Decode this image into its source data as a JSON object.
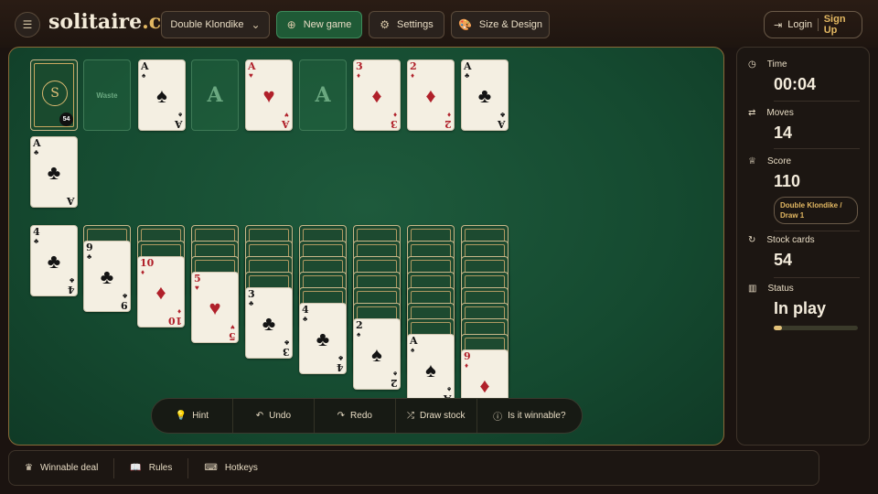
{
  "header": {
    "logo": {
      "main": "solitaire",
      "tld": ".cx"
    },
    "variant_label": "Double Klondike",
    "new_game_label": "New game",
    "settings_label": "Settings",
    "size_design_label": "Size & Design",
    "login_label": "Login",
    "signup_label": "Sign Up"
  },
  "board": {
    "stock_count": "54",
    "stock_emblem": "S",
    "waste_label": "Waste",
    "foundations": [
      {
        "rank": "A",
        "suit": "♠",
        "color": "blk"
      },
      {
        "rank": "A",
        "suit": "",
        "empty": true
      },
      {
        "rank": "A",
        "suit": "♥",
        "color": "red"
      },
      {
        "rank": "A",
        "suit": "",
        "empty": true
      },
      {
        "rank": "3",
        "suit": "♦",
        "color": "red"
      },
      {
        "rank": "2",
        "suit": "♦",
        "color": "red"
      },
      {
        "rank": "A",
        "suit": "♣",
        "color": "blk"
      },
      {
        "rank": "A",
        "suit": "♣",
        "color": "blk"
      }
    ],
    "tableau": [
      {
        "rank": "4",
        "suit": "♣",
        "color": "blk"
      },
      {
        "rank": "9",
        "suit": "♣",
        "color": "blk"
      },
      {
        "rank": "10",
        "suit": "♦",
        "color": "red"
      },
      {
        "rank": "5",
        "suit": "♥",
        "color": "red"
      },
      {
        "rank": "3",
        "suit": "♣",
        "color": "blk"
      },
      {
        "rank": "4",
        "suit": "♣",
        "color": "blk"
      },
      {
        "rank": "2",
        "suit": "♠",
        "color": "blk"
      },
      {
        "rank": "A",
        "suit": "♠",
        "color": "blk"
      },
      {
        "rank": "9",
        "suit": "♦",
        "color": "red"
      }
    ]
  },
  "actions": {
    "hint": "Hint",
    "undo": "Undo",
    "redo": "Redo",
    "draw_stock": "Draw stock",
    "winnable": "Is it winnable?"
  },
  "stats": {
    "time_label": "Time",
    "time_value": "00:04",
    "moves_label": "Moves",
    "moves_value": "14",
    "score_label": "Score",
    "score_value": "110",
    "mode_badge": "Double Klondike / Draw 1",
    "stock_label": "Stock cards",
    "stock_value": "54",
    "status_label": "Status",
    "status_value": "In play",
    "progress": 0.1
  },
  "footer": {
    "winnable_deal": "Winnable deal",
    "rules": "Rules",
    "hotkeys": "Hotkeys"
  }
}
